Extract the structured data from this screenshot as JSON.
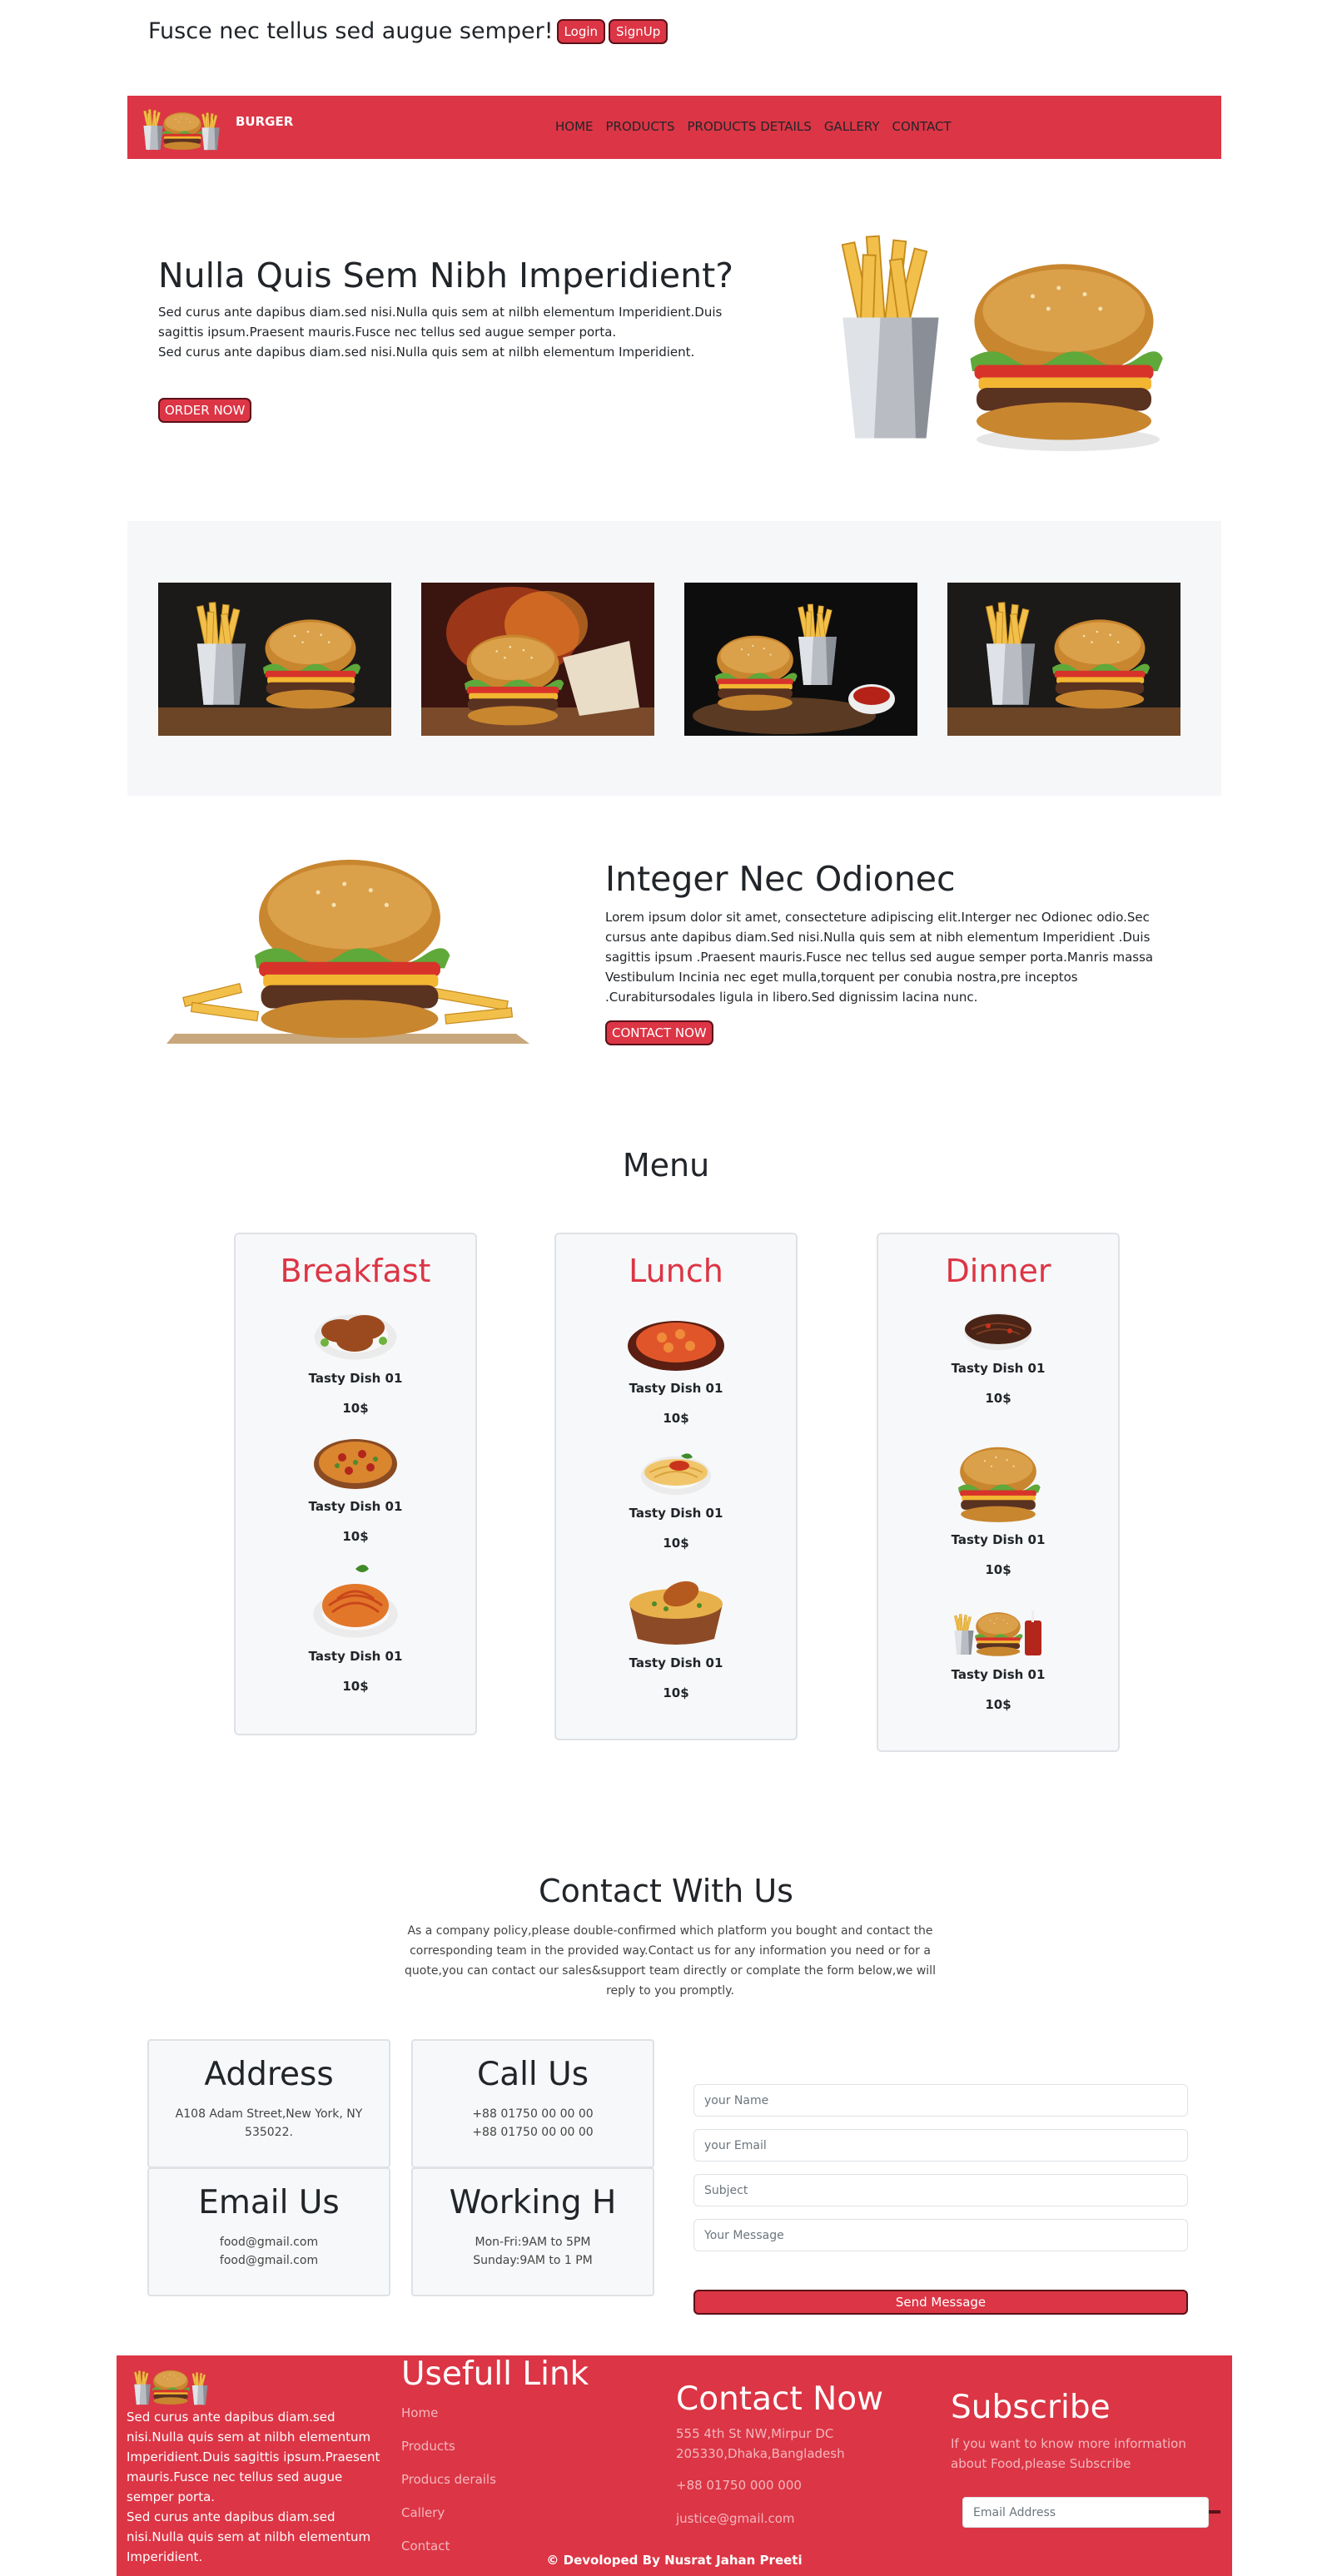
{
  "header": {
    "tagline": "Fusce nec tellus sed augue semper!",
    "login_label": "Login",
    "signup_label": "SignUp"
  },
  "nav": {
    "brand": "BURGER",
    "links": [
      "HOME",
      "PRODUCTS",
      "PRODUCTS DETAILS",
      "GALLERY",
      "CONTACT"
    ]
  },
  "hero": {
    "title": "Nulla Quis Sem Nibh Imperidient?",
    "paragraph1": "Sed curus ante dapibus diam.sed nisi.Nulla quis sem at nilbh elementum Imperidient.Duis sagittis ipsum.Praesent mauris.Fusce nec tellus sed augue semper porta.",
    "paragraph2": "Sed curus ante dapibus diam.sed nisi.Nulla quis sem at nilbh elementum Imperidient.",
    "button_label": "ORDER NOW"
  },
  "about": {
    "title": "Integer Nec Odionec",
    "text": "Lorem ipsum dolor sit amet, consecteture adipiscing elit.Interger nec Odionec odio.Sec cursus ante dapibus diam.Sed nisi.Nulla quis sem at nibh elementum Imperidient .Duis sagittis ipsum .Praesent mauris.Fusce nec tellus sed augue semper porta.Manris massa Vestibulum Incinia nec eget mulla,torquent per conubia nostra,pre inceptos .Curabitursodales ligula in libero.Sed dignissim lacina nunc.",
    "button_label": "CONTACT NOW"
  },
  "menu": {
    "title": "Menu",
    "categories": [
      {
        "title": "Breakfast",
        "dishes": [
          {
            "name": "Tasty Dish 01",
            "price": "10$",
            "icon": "chicken-drumsticks"
          },
          {
            "name": "Tasty Dish 01",
            "price": "10$",
            "icon": "pizza"
          },
          {
            "name": "Tasty Dish 01",
            "price": "10$",
            "icon": "spaghetti"
          }
        ]
      },
      {
        "title": "Lunch",
        "dishes": [
          {
            "name": "Tasty Dish 01",
            "price": "10$",
            "icon": "pasta-bowl"
          },
          {
            "name": "Tasty Dish 01",
            "price": "10$",
            "icon": "spaghetti-plate"
          },
          {
            "name": "Tasty Dish 01",
            "price": "10$",
            "icon": "chicken-rice-pot"
          }
        ]
      },
      {
        "title": "Dinner",
        "dishes": [
          {
            "name": "Tasty Dish 01",
            "price": "10$",
            "icon": "noodle-plate"
          },
          {
            "name": "Tasty Dish 01",
            "price": "10$",
            "icon": "burger"
          },
          {
            "name": "Tasty Dish 01",
            "price": "10$",
            "icon": "burger-combo"
          }
        ]
      }
    ]
  },
  "contact": {
    "title": "Contact With Us",
    "text": "As a company policy,please double-confirmed which platform you bought and contact the corresponding team in the provided way.Contact us for any information you need or for a quote,you can contact our sales&support team directly or complate the form below,we will reply to you promptly.",
    "cards": [
      {
        "title": "Address",
        "lines": [
          "A108 Adam Street,New York, NY",
          "535022."
        ]
      },
      {
        "title": "Call Us",
        "lines": [
          "+88 01750 00 00 00",
          "+88 01750 00 00 00"
        ]
      },
      {
        "title": "Email Us",
        "lines": [
          "food@gmail.com",
          "food@gmail.com"
        ]
      },
      {
        "title": "Working H",
        "lines": [
          "Mon-Fri:9AM to 5PM",
          "Sunday:9AM to 1 PM"
        ]
      }
    ],
    "form": {
      "name_placeholder": "your Name",
      "email_placeholder": "your Email",
      "subject_placeholder": "Subject",
      "message_placeholder": "Your Message",
      "send_label": "Send Message"
    }
  },
  "footer": {
    "about_p1": "Sed curus ante dapibus diam.sed nisi.Nulla quis sem at nilbh elementum Imperidient.Duis sagittis ipsum.Praesent mauris.Fusce nec tellus sed augue semper porta.",
    "about_p2": "Sed curus ante dapibus diam.sed nisi.Nulla quis sem at nilbh elementum Imperidient.",
    "links_title": "Usefull Link",
    "links": [
      "Home",
      "Products",
      "Producs derails",
      "Callery",
      "Contact"
    ],
    "contact_title": "Contact Now",
    "address_line1": "555 4th St NW,Mirpur DC",
    "address_line2": "205330,Dhaka,Bangladesh",
    "phone": "+88 01750 000 000",
    "email": "justice@gmail.com",
    "subscribe_title": "Subscribe",
    "subscribe_text1": "If you want to know more information",
    "subscribe_text2": "about Food,please Subscribe",
    "email_placeholder": "Email Address",
    "credit": "© Devoloped By Nusrat Jahan Preeti"
  },
  "colors": {
    "brand_red": "#dc3545",
    "panel_gray": "#f7f8f9",
    "text_dark": "#212529"
  }
}
